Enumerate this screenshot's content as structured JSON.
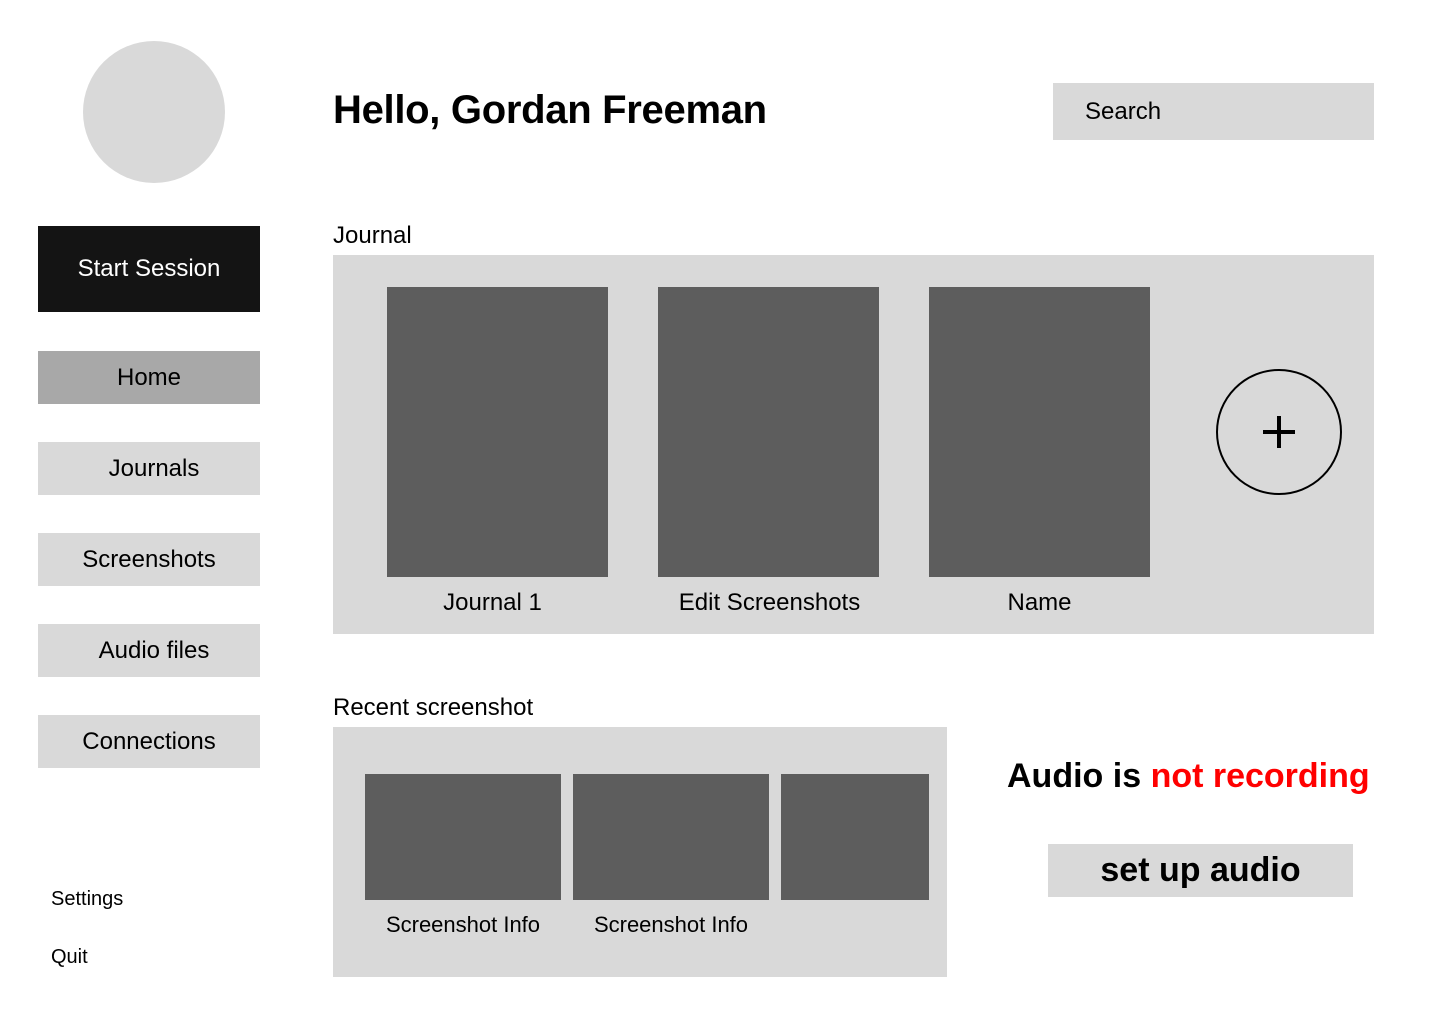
{
  "colors": {
    "primary_button_bg": "#141414",
    "panel_bg": "#d9d9d9",
    "active_nav_bg": "#a8a8a8",
    "thumbnail_bg": "#5d5d5d",
    "warning": "#ff0000"
  },
  "sidebar": {
    "start_session_label": "Start Session",
    "items": [
      {
        "label": "Home",
        "active": true
      },
      {
        "label": "Journals",
        "active": false
      },
      {
        "label": "Screenshots",
        "active": false
      },
      {
        "label": "Audio files",
        "active": false
      },
      {
        "label": "Connections",
        "active": false
      }
    ],
    "settings_label": "Settings",
    "quit_label": "Quit"
  },
  "header": {
    "greeting": "Hello, Gordan Freeman",
    "search_placeholder": "Search"
  },
  "journal": {
    "section_label": "Journal",
    "cards": [
      {
        "label": "Journal 1"
      },
      {
        "label": "Edit Screenshots"
      },
      {
        "label": "Name"
      }
    ],
    "add_icon": "plus-icon"
  },
  "recent": {
    "section_label": "Recent screenshot",
    "items": [
      {
        "info": "Screenshot Info"
      },
      {
        "info": "Screenshot Info"
      },
      {
        "info": ""
      }
    ]
  },
  "audio": {
    "status_prefix": "Audio is",
    "status_state": "not recording",
    "setup_label": "set up audio"
  }
}
